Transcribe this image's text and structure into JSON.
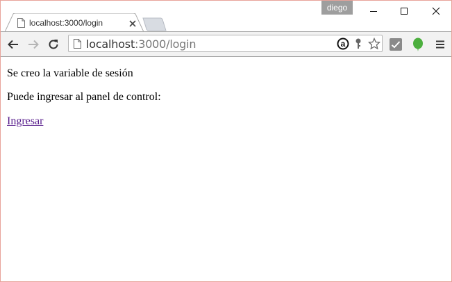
{
  "browser": {
    "profile_name": "diego",
    "tab": {
      "title": "localhost:3000/login"
    },
    "omnibox": {
      "url_host": "localhost",
      "url_rest": ":3000/login"
    },
    "icons": {
      "back": "back-arrow-icon",
      "forward": "forward-arrow-icon",
      "reload": "reload-icon",
      "page": "page-icon",
      "amazon": "amazon-assistant-icon",
      "key": "key-icon",
      "star": "bookmark-star-icon",
      "ext_check": "checkmark-extension-icon",
      "evernote": "evernote-icon",
      "menu": "hamburger-menu-icon"
    },
    "colors": {
      "window_border": "#e8a39a",
      "toolbar": "#f2f2f2",
      "visited_link": "#551a8b",
      "evernote": "#4caf3e",
      "profile_badge": "#9e9e9e"
    }
  },
  "page": {
    "line1": "Se creo la variable de sesión",
    "line2": "Puede ingresar al panel de control:",
    "link_label": "Ingresar"
  }
}
